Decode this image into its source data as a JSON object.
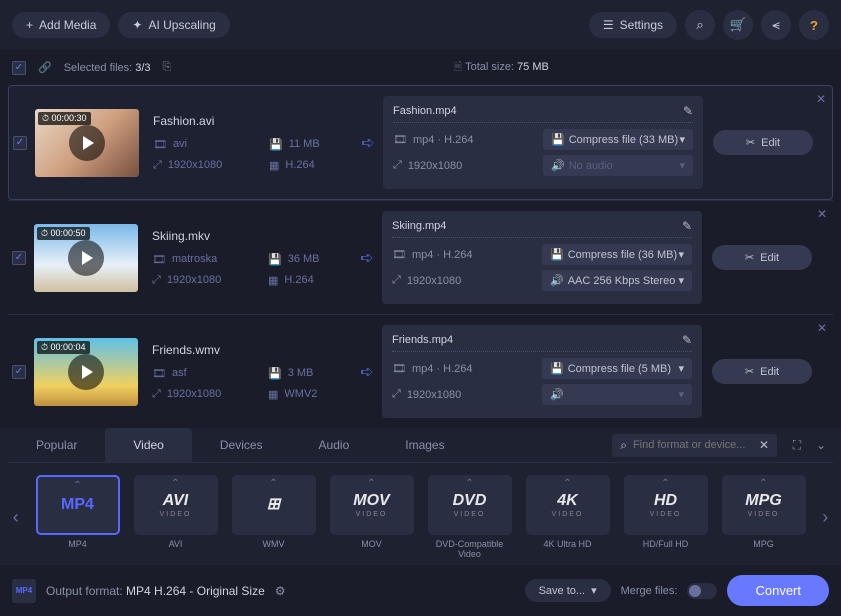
{
  "topbar": {
    "add_media": "Add Media",
    "ai_upscaling": "AI Upscaling",
    "settings": "Settings"
  },
  "selection": {
    "label": "Selected files:",
    "count": "3/3",
    "total_label": "Total size:",
    "total_value": "75 MB"
  },
  "files": [
    {
      "duration": "00:00:30",
      "src_name": "Fashion.avi",
      "container": "avi",
      "size": "11 MB",
      "resolution": "1920x1080",
      "codec": "H.264",
      "out_name": "Fashion.mp4",
      "out_format": "mp4 · H.264",
      "compress": "Compress file (33 MB)",
      "out_res": "1920x1080",
      "audio": "No audio",
      "audio_dim": true
    },
    {
      "duration": "00:00:50",
      "src_name": "Skiing.mkv",
      "container": "matroska",
      "size": "36 MB",
      "resolution": "1920x1080",
      "codec": "H.264",
      "out_name": "Skiing.mp4",
      "out_format": "mp4 · H.264",
      "compress": "Compress file (36 MB)",
      "out_res": "1920x1080",
      "audio": "AAC 256 Kbps Stereo",
      "audio_dim": false
    },
    {
      "duration": "00:00:04",
      "src_name": "Friends.wmv",
      "container": "asf",
      "size": "3 MB",
      "resolution": "1920x1080",
      "codec": "WMV2",
      "out_name": "Friends.mp4",
      "out_format": "mp4 · H.264",
      "compress": "Compress file (5 MB)",
      "out_res": "1920x1080",
      "audio": "",
      "audio_dim": true
    }
  ],
  "edit_label": "Edit",
  "tabs": [
    "Popular",
    "Video",
    "Devices",
    "Audio",
    "Images"
  ],
  "active_tab": 1,
  "search_placeholder": "Find format or device...",
  "formats": [
    {
      "logo": "MP4",
      "sub": "",
      "label": "MP4",
      "active": true,
      "cls": "mp4"
    },
    {
      "logo": "AVI",
      "sub": "VIDEO",
      "label": "AVI"
    },
    {
      "logo": "⊞",
      "sub": "",
      "label": "WMV"
    },
    {
      "logo": "MOV",
      "sub": "VIDEO",
      "label": "MOV"
    },
    {
      "logo": "DVD",
      "sub": "VIDEO",
      "label": "DVD-Compatible Video"
    },
    {
      "logo": "4K",
      "sub": "VIDEO",
      "label": "4K Ultra HD"
    },
    {
      "logo": "HD",
      "sub": "VIDEO",
      "label": "HD/Full HD"
    },
    {
      "logo": "MPG",
      "sub": "VIDEO",
      "label": "MPG"
    }
  ],
  "bottom": {
    "output_label": "Output format:",
    "output_value": "MP4 H.264 - Original Size",
    "save_to": "Save to...",
    "merge": "Merge files:",
    "convert": "Convert"
  }
}
